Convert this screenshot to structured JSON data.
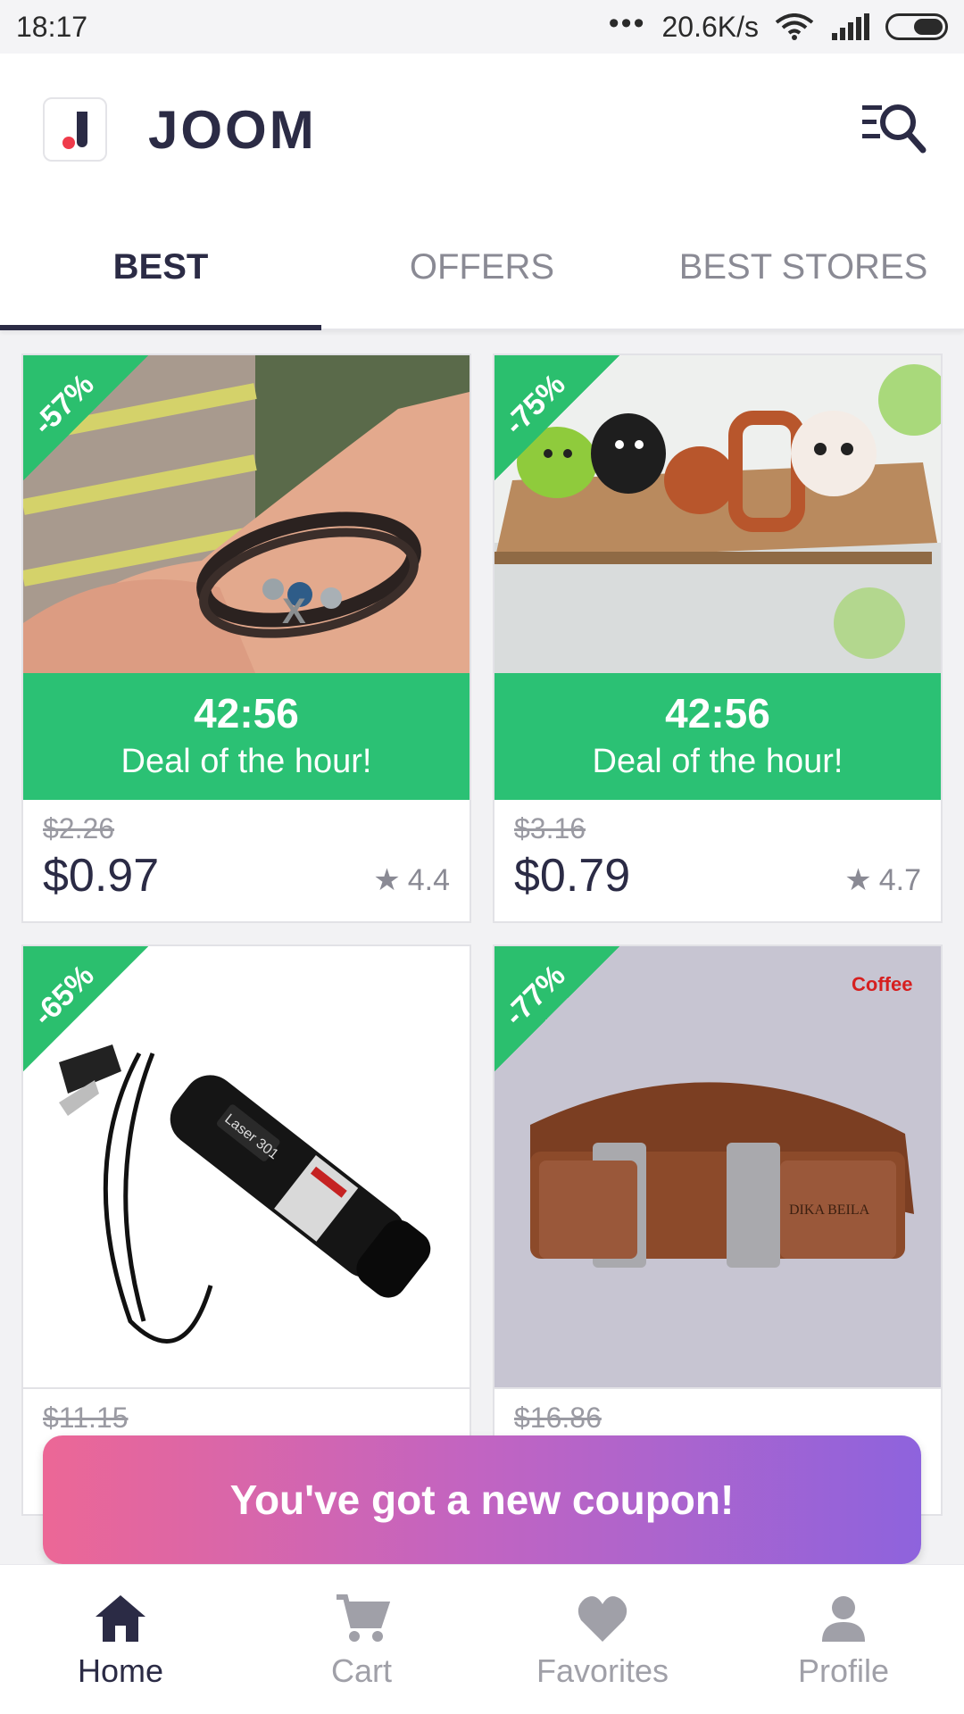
{
  "status_bar": {
    "time": "18:17",
    "dots": "•••",
    "speed": "20.6K/s"
  },
  "header": {
    "brand": "JOOM"
  },
  "tabs": [
    {
      "label": "BEST",
      "active": true
    },
    {
      "label": "OFFERS",
      "active": false
    },
    {
      "label": "BEST STORES",
      "active": false
    }
  ],
  "products": [
    {
      "discount": "-57%",
      "timer": "42:56",
      "deal_label": "Deal of the hour!",
      "old_price": "$2.26",
      "price": "$0.97",
      "rating": "4.4"
    },
    {
      "discount": "-75%",
      "timer": "42:56",
      "deal_label": "Deal of the hour!",
      "old_price": "$3.16",
      "price": "$0.79",
      "rating": "4.7"
    },
    {
      "discount": "-65%",
      "old_price": "$11.15",
      "image_text": "Laser 301"
    },
    {
      "discount": "-77%",
      "old_price": "$16.86",
      "image_text": "Coffee"
    }
  ],
  "coupon": {
    "text": "You've got a new coupon!"
  },
  "bottom_nav": [
    {
      "label": "Home",
      "icon": "home-icon",
      "active": true
    },
    {
      "label": "Cart",
      "icon": "cart-icon",
      "active": false
    },
    {
      "label": "Favorites",
      "icon": "heart-icon",
      "active": false
    },
    {
      "label": "Profile",
      "icon": "person-icon",
      "active": false
    }
  ],
  "colors": {
    "accent": "#2bc174",
    "brand": "#2b2b45",
    "logo_dot": "#ef3b4b"
  }
}
